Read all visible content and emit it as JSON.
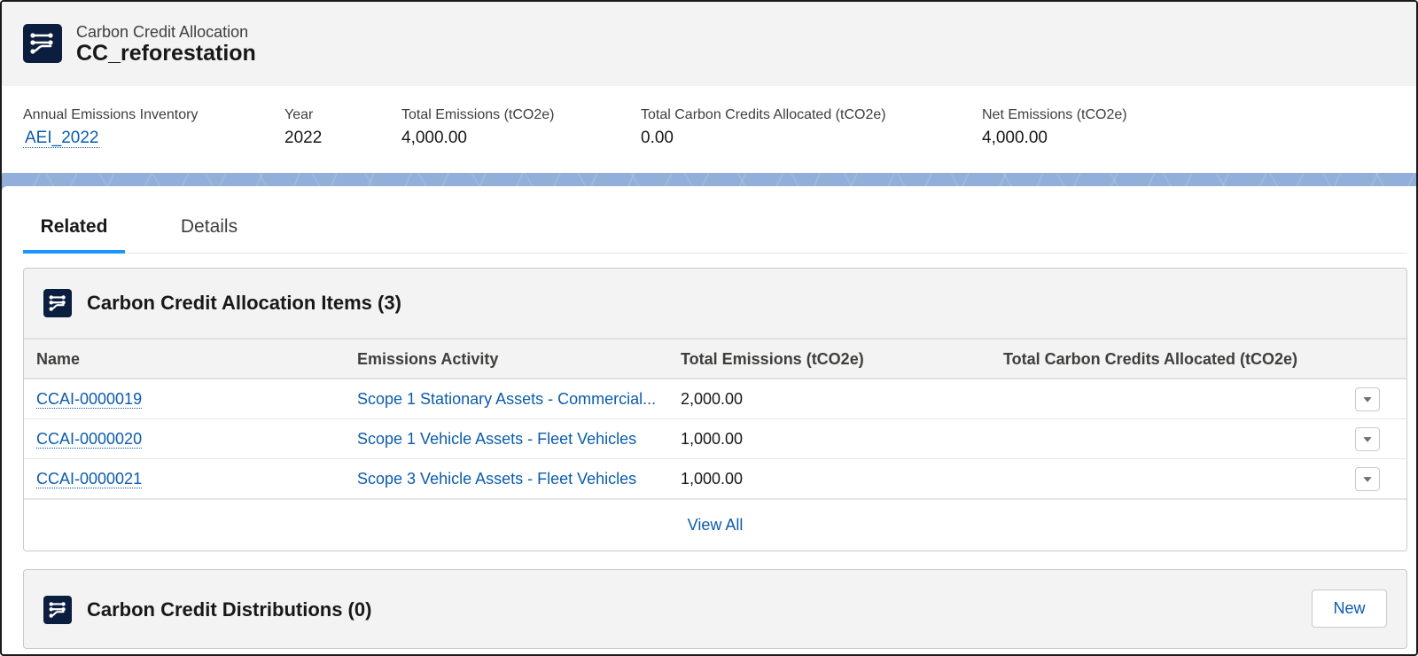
{
  "record": {
    "object_type": "Carbon Credit Allocation",
    "name": "CC_reforestation",
    "icon": "flow-icon"
  },
  "highlights": [
    {
      "label": "Annual Emissions Inventory",
      "value": "AEI_2022",
      "is_link": true
    },
    {
      "label": "Year",
      "value": "2022",
      "is_link": false
    },
    {
      "label": "Total Emissions (tCO2e)",
      "value": "4,000.00",
      "is_link": false
    },
    {
      "label": "Total Carbon Credits Allocated (tCO2e)",
      "value": "0.00",
      "is_link": false
    },
    {
      "label": "Net Emissions (tCO2e)",
      "value": "4,000.00",
      "is_link": false
    }
  ],
  "tabs": [
    {
      "label": "Related",
      "active": true
    },
    {
      "label": "Details",
      "active": false
    }
  ],
  "related_lists": {
    "items": {
      "title": "Carbon Credit Allocation Items (3)",
      "columns": [
        "Name",
        "Emissions Activity",
        "Total Emissions (tCO2e)",
        "Total Carbon Credits Allocated (tCO2e)"
      ],
      "rows": [
        {
          "name": "CCAI-0000019",
          "activity": "Scope 1 Stationary Assets - Commercial...",
          "total_emissions": "2,000.00",
          "credits_allocated": ""
        },
        {
          "name": "CCAI-0000020",
          "activity": "Scope 1 Vehicle Assets - Fleet Vehicles",
          "total_emissions": "1,000.00",
          "credits_allocated": ""
        },
        {
          "name": "CCAI-0000021",
          "activity": "Scope 3 Vehicle Assets - Fleet Vehicles",
          "total_emissions": "1,000.00",
          "credits_allocated": ""
        }
      ],
      "view_all_label": "View All"
    },
    "distributions": {
      "title": "Carbon Credit Distributions (0)",
      "new_label": "New"
    }
  },
  "colors": {
    "icon_bg": "#0b1e3f",
    "link": "#0b5cab",
    "tab_active": "#1b96ff",
    "band": "#92afd9"
  }
}
